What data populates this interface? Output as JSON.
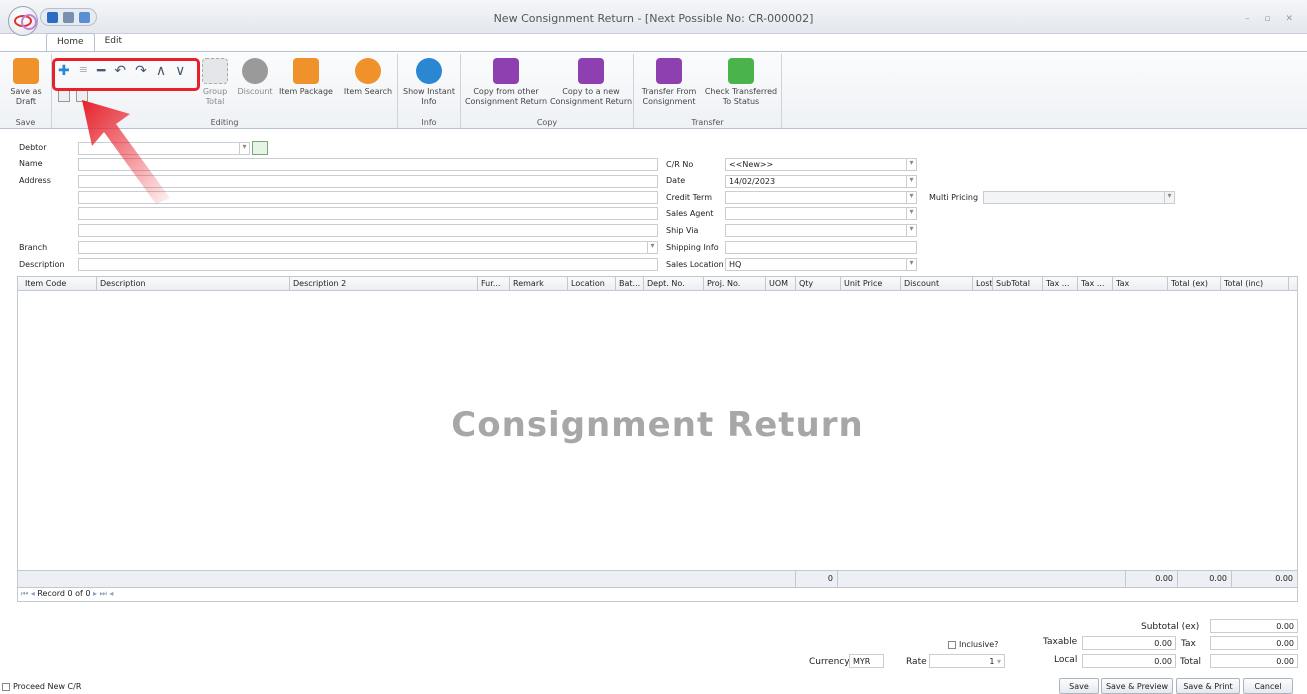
{
  "window": {
    "title": "New Consignment Return - [Next Possible No: CR-000002]"
  },
  "tabs": [
    "Home",
    "Edit"
  ],
  "ribbon": {
    "save_draft": "Save as Draft",
    "group_save": "Save",
    "group_total": "Group Total",
    "discount": "Discount",
    "item_package": "Item Package",
    "item_search": "Item Search",
    "group_editing": "Editing",
    "show_instant_info": "Show Instant Info",
    "group_info": "Info",
    "copy_from_other": "Copy from other Consignment Return",
    "copy_to_new": "Copy to a new Consignment Return",
    "group_copy": "Copy",
    "transfer_from": "Transfer From Consignment",
    "check_transferred": "Check Transferred To Status",
    "group_transfer": "Transfer"
  },
  "form": {
    "debtor_label": "Debtor",
    "name_label": "Name",
    "address_label": "Address",
    "branch_label": "Branch",
    "description_label": "Description",
    "cr_no_label": "C/R No",
    "cr_no_value": "<<New>>",
    "date_label": "Date",
    "date_value": "14/02/2023",
    "credit_term_label": "Credit Term",
    "sales_agent_label": "Sales Agent",
    "ship_via_label": "Ship Via",
    "shipping_info_label": "Shipping Info",
    "sales_location_label": "Sales Location",
    "sales_location_value": "HQ",
    "multi_pricing_label": "Multi Pricing"
  },
  "grid": {
    "columns": [
      "Item Code",
      "Description",
      "Description 2",
      "Fur...",
      "Remark",
      "Location",
      "Bat...",
      "Dept. No.",
      "Proj. No.",
      "UOM",
      "Qty",
      "Unit Price",
      "Discount",
      "Lost?",
      "SubTotal",
      "Tax ...",
      "Tax ...",
      "Tax",
      "Total (ex)",
      "Total (inc)"
    ],
    "watermark": "Consignment Return",
    "footer_qty": "0",
    "footer_tax": "0.00",
    "footer_total_ex": "0.00",
    "footer_total_inc": "0.00",
    "record_nav": "Record 0 of 0"
  },
  "totals": {
    "subtotal_label": "Subtotal (ex)",
    "subtotal_value": "0.00",
    "inclusive_label": "Inclusive?",
    "taxable_label": "Taxable",
    "taxable_value": "0.00",
    "tax_label": "Tax",
    "tax_value": "0.00",
    "local_label": "Local",
    "local_value": "0.00",
    "total_label": "Total",
    "total_value": "0.00",
    "currency_label": "Currency",
    "currency_value": "MYR",
    "rate_label": "Rate",
    "rate_value": "1"
  },
  "footer": {
    "proceed_new": "Proceed New C/R",
    "save": "Save",
    "save_preview": "Save & Preview",
    "save_print": "Save & Print",
    "cancel": "Cancel"
  }
}
